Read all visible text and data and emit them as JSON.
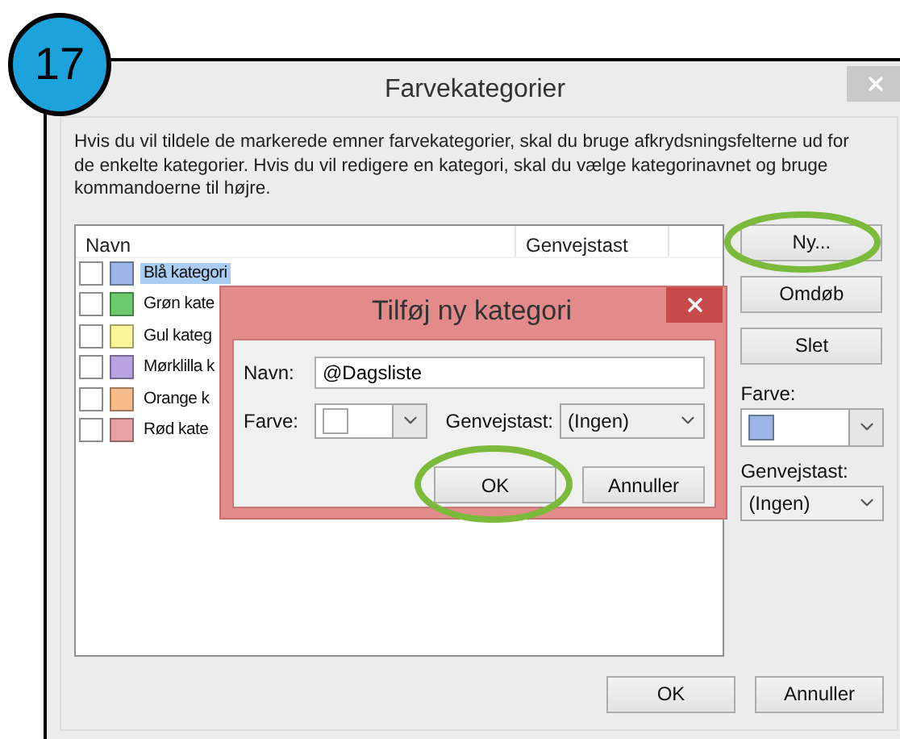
{
  "badge": "17",
  "window": {
    "title": "Farvekategorier"
  },
  "description": "Hvis du vil tildele de markerede emner farvekategorier, skal du bruge afkrydsningsfelterne ud for de enkelte kategorier. Hvis du vil redigere en kategori, skal du vælge kategorinavnet og bruge kommandoerne til højre.",
  "list": {
    "columns": [
      "Navn",
      "Genvejstast"
    ],
    "rows": [
      {
        "label": "Blå kategori",
        "color": "#9bb5e6",
        "checked": false,
        "selected": true
      },
      {
        "label": "Grøn kate",
        "color": "#6cc96c",
        "checked": false,
        "selected": false
      },
      {
        "label": "Gul kateg",
        "color": "#fdf59a",
        "checked": false,
        "selected": false
      },
      {
        "label": "Mørklilla k",
        "color": "#b9a2e0",
        "checked": false,
        "selected": false
      },
      {
        "label": "Orange k",
        "color": "#f8bb8c",
        "checked": false,
        "selected": false
      },
      {
        "label": "Rød kate",
        "color": "#e9a1a4",
        "checked": false,
        "selected": false
      }
    ]
  },
  "side": {
    "buttons": [
      {
        "label": "Ny...",
        "highlighted": true
      },
      {
        "label": "Omdøb",
        "highlighted": false
      },
      {
        "label": "Slet",
        "highlighted": false
      }
    ],
    "color_label": "Farve:",
    "color": "#9bb5e6",
    "shortcut_label": "Genvejstast:",
    "shortcut_value": "(Ingen)"
  },
  "footer": [
    {
      "label": "OK",
      "highlighted": false
    },
    {
      "label": "Annuller",
      "highlighted": false
    }
  ],
  "subdialog": {
    "title": "Tilføj ny kategori",
    "name_label": "Navn:",
    "name_value": "@Dagsliste",
    "color_label": "Farve:",
    "color": "#ffffff",
    "shortcut_label": "Genvejstast:",
    "shortcut_value": "(Ingen)",
    "buttons": [
      {
        "label": "OK",
        "highlighted": true
      },
      {
        "label": "Annuller",
        "highlighted": false
      }
    ]
  }
}
